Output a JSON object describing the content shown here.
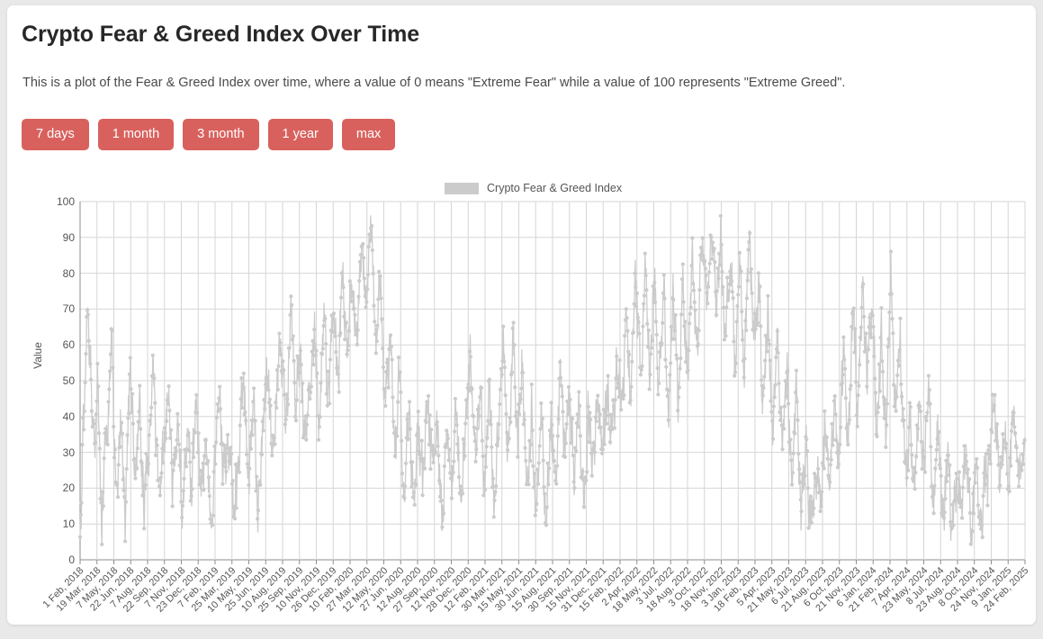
{
  "page": {
    "title": "Crypto Fear & Greed Index Over Time",
    "description": "This is a plot of the Fear & Greed Index over time, where a value of 0 means \"Extreme Fear\" while a value of 100 represents \"Extreme Greed\".",
    "background_color": "#e9e9e9",
    "card_color": "#ffffff"
  },
  "range_buttons": [
    {
      "label": "7 days",
      "name": "range-7-days"
    },
    {
      "label": "1 month",
      "name": "range-1-month"
    },
    {
      "label": "3 month",
      "name": "range-3-month"
    },
    {
      "label": "1 year",
      "name": "range-1-year"
    },
    {
      "label": "max",
      "name": "range-max"
    }
  ],
  "button_color": "#d9615d",
  "series_color": "#cbcbcb",
  "chart_data": {
    "type": "line",
    "title": "",
    "xlabel": "",
    "ylabel": "Value",
    "ylim": [
      0,
      100
    ],
    "ytick_step": 10,
    "yticks": [
      0,
      10,
      20,
      30,
      40,
      50,
      60,
      70,
      80,
      90,
      100
    ],
    "grid": true,
    "legend_position": "top-center",
    "legend": [
      "Crypto Fear & Greed Index"
    ],
    "marker": "circle",
    "x_tick_rotation": -45,
    "categories": [
      "1 Feb, 2018",
      "19 Mar, 2018",
      "7 May, 2018",
      "22 Jun, 2018",
      "7 Aug, 2018",
      "22 Sep, 2018",
      "7 Nov, 2018",
      "23 Dec, 2018",
      "7 Feb, 2019",
      "25 Mar, 2019",
      "10 May, 2019",
      "25 Jun, 2019",
      "10 Aug, 2019",
      "25 Sep, 2019",
      "10 Nov, 2019",
      "26 Dec, 2019",
      "10 Feb, 2020",
      "27 Mar, 2020",
      "12 May, 2020",
      "27 Jun, 2020",
      "12 Aug, 2020",
      "27 Sep, 2020",
      "12 Nov, 2020",
      "28 Dec, 2020",
      "12 Feb, 2021",
      "30 Mar, 2021",
      "15 May, 2021",
      "30 Jun, 2021",
      "15 Aug, 2021",
      "30 Sep, 2021",
      "15 Nov, 2021",
      "31 Dec, 2021",
      "15 Feb, 2022",
      "2 Apr, 2022",
      "18 May, 2022",
      "3 Jul, 2022",
      "18 Aug, 2022",
      "3 Oct, 2022",
      "18 Nov, 2022",
      "3 Jan, 2023",
      "18 Feb, 2023",
      "5 Apr, 2023",
      "21 May, 2023",
      "6 Jul, 2023",
      "21 Aug, 2023",
      "6 Oct, 2023",
      "21 Nov, 2023",
      "6 Jan, 2024",
      "21 Feb, 2024",
      "7 Apr, 2024",
      "23 May, 2024",
      "8 Jul, 2024",
      "23 Aug, 2024",
      "8 Oct, 2024",
      "24 Nov, 2024",
      "9 Jan, 2025",
      "24 Feb, 2025"
    ],
    "series": [
      {
        "name": "Crypto Fear & Greed Index",
        "color": "#cbcbcb",
        "anchors": [
          [
            0.0,
            9
          ],
          [
            0.004,
            40
          ],
          [
            0.008,
            74
          ],
          [
            0.014,
            32
          ],
          [
            0.019,
            48
          ],
          [
            0.023,
            11
          ],
          [
            0.028,
            33
          ],
          [
            0.033,
            63
          ],
          [
            0.038,
            19
          ],
          [
            0.043,
            40
          ],
          [
            0.048,
            15
          ],
          [
            0.053,
            55
          ],
          [
            0.058,
            20
          ],
          [
            0.063,
            44
          ],
          [
            0.068,
            13
          ],
          [
            0.073,
            36
          ],
          [
            0.078,
            54
          ],
          [
            0.083,
            17
          ],
          [
            0.088,
            30
          ],
          [
            0.093,
            48
          ],
          [
            0.098,
            22
          ],
          [
            0.103,
            42
          ],
          [
            0.108,
            12
          ],
          [
            0.113,
            34
          ],
          [
            0.118,
            22
          ],
          [
            0.123,
            48
          ],
          [
            0.128,
            17
          ],
          [
            0.133,
            30
          ],
          [
            0.138,
            11
          ],
          [
            0.143,
            28
          ],
          [
            0.148,
            45
          ],
          [
            0.153,
            24
          ],
          [
            0.158,
            36
          ],
          [
            0.163,
            14
          ],
          [
            0.168,
            30
          ],
          [
            0.173,
            52
          ],
          [
            0.178,
            25
          ],
          [
            0.183,
            40
          ],
          [
            0.188,
            15
          ],
          [
            0.193,
            34
          ],
          [
            0.198,
            56
          ],
          [
            0.203,
            29
          ],
          [
            0.208,
            48
          ],
          [
            0.213,
            62
          ],
          [
            0.218,
            35
          ],
          [
            0.223,
            69
          ],
          [
            0.228,
            42
          ],
          [
            0.233,
            58
          ],
          [
            0.238,
            30
          ],
          [
            0.243,
            52
          ],
          [
            0.248,
            64
          ],
          [
            0.253,
            39
          ],
          [
            0.258,
            70
          ],
          [
            0.263,
            45
          ],
          [
            0.268,
            72
          ],
          [
            0.273,
            50
          ],
          [
            0.278,
            80
          ],
          [
            0.283,
            57
          ],
          [
            0.288,
            84
          ],
          [
            0.293,
            62
          ],
          [
            0.298,
            88
          ],
          [
            0.303,
            70
          ],
          [
            0.308,
            95
          ],
          [
            0.313,
            60
          ],
          [
            0.318,
            78
          ],
          [
            0.323,
            38
          ],
          [
            0.328,
            62
          ],
          [
            0.333,
            27
          ],
          [
            0.338,
            50
          ],
          [
            0.343,
            18
          ],
          [
            0.348,
            42
          ],
          [
            0.353,
            16
          ],
          [
            0.358,
            39
          ],
          [
            0.363,
            22
          ],
          [
            0.368,
            41
          ],
          [
            0.373,
            25
          ],
          [
            0.378,
            43
          ],
          [
            0.383,
            6
          ],
          [
            0.388,
            40
          ],
          [
            0.393,
            20
          ],
          [
            0.398,
            41
          ],
          [
            0.403,
            14
          ],
          [
            0.408,
            38
          ],
          [
            0.413,
            56
          ],
          [
            0.418,
            30
          ],
          [
            0.423,
            49
          ],
          [
            0.428,
            21
          ],
          [
            0.433,
            47
          ],
          [
            0.438,
            15
          ],
          [
            0.443,
            39
          ],
          [
            0.448,
            60
          ],
          [
            0.453,
            27
          ],
          [
            0.458,
            63
          ],
          [
            0.463,
            33
          ],
          [
            0.468,
            55
          ],
          [
            0.473,
            19
          ],
          [
            0.478,
            46
          ],
          [
            0.483,
            8
          ],
          [
            0.488,
            38
          ],
          [
            0.493,
            12
          ],
          [
            0.498,
            36
          ],
          [
            0.503,
            20
          ],
          [
            0.508,
            55
          ],
          [
            0.513,
            30
          ],
          [
            0.518,
            48
          ],
          [
            0.523,
            22
          ],
          [
            0.528,
            44
          ],
          [
            0.533,
            18
          ],
          [
            0.538,
            42
          ],
          [
            0.543,
            24
          ],
          [
            0.548,
            46
          ],
          [
            0.553,
            28
          ],
          [
            0.558,
            50
          ],
          [
            0.563,
            34
          ],
          [
            0.568,
            60
          ],
          [
            0.573,
            40
          ],
          [
            0.578,
            68
          ],
          [
            0.583,
            44
          ],
          [
            0.588,
            76
          ],
          [
            0.593,
            50
          ],
          [
            0.598,
            83
          ],
          [
            0.603,
            55
          ],
          [
            0.608,
            84
          ],
          [
            0.613,
            47
          ],
          [
            0.618,
            72
          ],
          [
            0.623,
            40
          ],
          [
            0.628,
            75
          ],
          [
            0.633,
            45
          ],
          [
            0.638,
            80
          ],
          [
            0.643,
            52
          ],
          [
            0.648,
            85
          ],
          [
            0.653,
            60
          ],
          [
            0.658,
            90
          ],
          [
            0.663,
            68
          ],
          [
            0.668,
            93
          ],
          [
            0.673,
            72
          ],
          [
            0.678,
            95
          ],
          [
            0.683,
            62
          ],
          [
            0.688,
            88
          ],
          [
            0.693,
            55
          ],
          [
            0.698,
            82
          ],
          [
            0.703,
            48
          ],
          [
            0.708,
            94
          ],
          [
            0.713,
            60
          ],
          [
            0.718,
            78
          ],
          [
            0.723,
            40
          ],
          [
            0.728,
            70
          ],
          [
            0.733,
            34
          ],
          [
            0.738,
            66
          ],
          [
            0.743,
            28
          ],
          [
            0.748,
            55
          ],
          [
            0.753,
            22
          ],
          [
            0.758,
            44
          ],
          [
            0.763,
            13
          ],
          [
            0.768,
            30
          ],
          [
            0.773,
            10
          ],
          [
            0.778,
            26
          ],
          [
            0.783,
            20
          ],
          [
            0.788,
            34
          ],
          [
            0.793,
            22
          ],
          [
            0.798,
            42
          ],
          [
            0.803,
            26
          ],
          [
            0.808,
            57
          ],
          [
            0.813,
            32
          ],
          [
            0.818,
            74
          ],
          [
            0.823,
            40
          ],
          [
            0.828,
            80
          ],
          [
            0.833,
            48
          ],
          [
            0.838,
            73
          ],
          [
            0.843,
            38
          ],
          [
            0.848,
            62
          ],
          [
            0.853,
            30
          ],
          [
            0.858,
            84
          ],
          [
            0.863,
            46
          ],
          [
            0.868,
            56
          ],
          [
            0.873,
            24
          ],
          [
            0.878,
            38
          ],
          [
            0.883,
            20
          ],
          [
            0.888,
            48
          ],
          [
            0.893,
            26
          ],
          [
            0.898,
            52
          ],
          [
            0.903,
            18
          ],
          [
            0.908,
            33
          ],
          [
            0.913,
            12
          ],
          [
            0.918,
            27
          ],
          [
            0.923,
            10
          ],
          [
            0.928,
            24
          ],
          [
            0.933,
            14
          ],
          [
            0.938,
            30
          ],
          [
            0.943,
            9
          ],
          [
            0.948,
            22
          ],
          [
            0.953,
            7
          ],
          [
            0.958,
            20
          ],
          [
            0.963,
            30
          ],
          [
            0.968,
            46
          ],
          [
            0.973,
            21
          ],
          [
            0.978,
            36
          ],
          [
            0.983,
            22
          ],
          [
            0.988,
            40
          ],
          [
            0.993,
            25
          ],
          [
            0.998,
            34
          ]
        ]
      }
    ]
  }
}
